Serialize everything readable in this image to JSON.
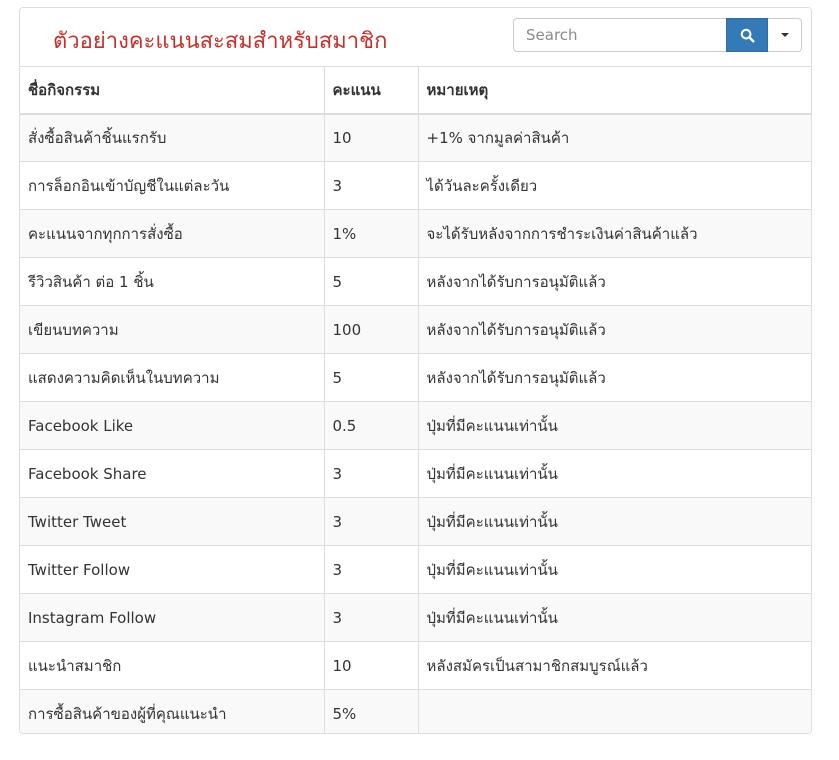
{
  "title": "ตัวอย่างคะแนนสะสมสำหรับสมาชิก",
  "search": {
    "placeholder": "Search"
  },
  "icons": {
    "search": "search-icon",
    "dropdown": "chevron-down-icon"
  },
  "colors": {
    "title": "#c9302c",
    "search_button": "#337ab7",
    "stripe": "#f9f9f9"
  },
  "table": {
    "headers": [
      "ชื่อกิจกรรม",
      "คะแนน",
      "หมายเหตุ"
    ],
    "rows": [
      [
        "สั่งซื้อสินค้าชิ้นแรกรับ",
        "10",
        "+1% จากมูลค่าสินค้า"
      ],
      [
        "การล็อกอินเข้าบัญชีในแต่ละวัน",
        "3",
        "ได้วันละครั้งเดียว"
      ],
      [
        "คะแนนจากทุกการสั่งซื้อ",
        "1%",
        "จะได้รับหลังจากการชำระเงินค่าสินค้าแล้ว"
      ],
      [
        "รีวิวสินค้า ต่อ 1 ชิ้น",
        "5",
        "หลังจากได้รับการอนุมัติแล้ว"
      ],
      [
        "เขียนบทความ",
        "100",
        "หลังจากได้รับการอนุมัติแล้ว"
      ],
      [
        "แสดงความคิดเห็นในบทความ",
        "5",
        "หลังจากได้รับการอนุมัติแล้ว"
      ],
      [
        "Facebook Like",
        "0.5",
        "ปุ่มที่มีคะแนนเท่านั้น"
      ],
      [
        "Facebook Share",
        "3",
        "ปุ่มที่มีคะแนนเท่านั้น"
      ],
      [
        "Twitter Tweet",
        "3",
        "ปุ่มที่มีคะแนนเท่านั้น"
      ],
      [
        "Twitter Follow",
        "3",
        "ปุ่มที่มีคะแนนเท่านั้น"
      ],
      [
        "Instagram Follow",
        "3",
        "ปุ่มที่มีคะแนนเท่านั้น"
      ],
      [
        "แนะนำสมาชิก",
        "10",
        "หลังสมัครเป็นสามาชิกสมบูรณ์แล้ว"
      ],
      [
        "การซื้อสินค้าของผู้ที่คุณแนะนำ",
        "5%",
        ""
      ]
    ]
  }
}
